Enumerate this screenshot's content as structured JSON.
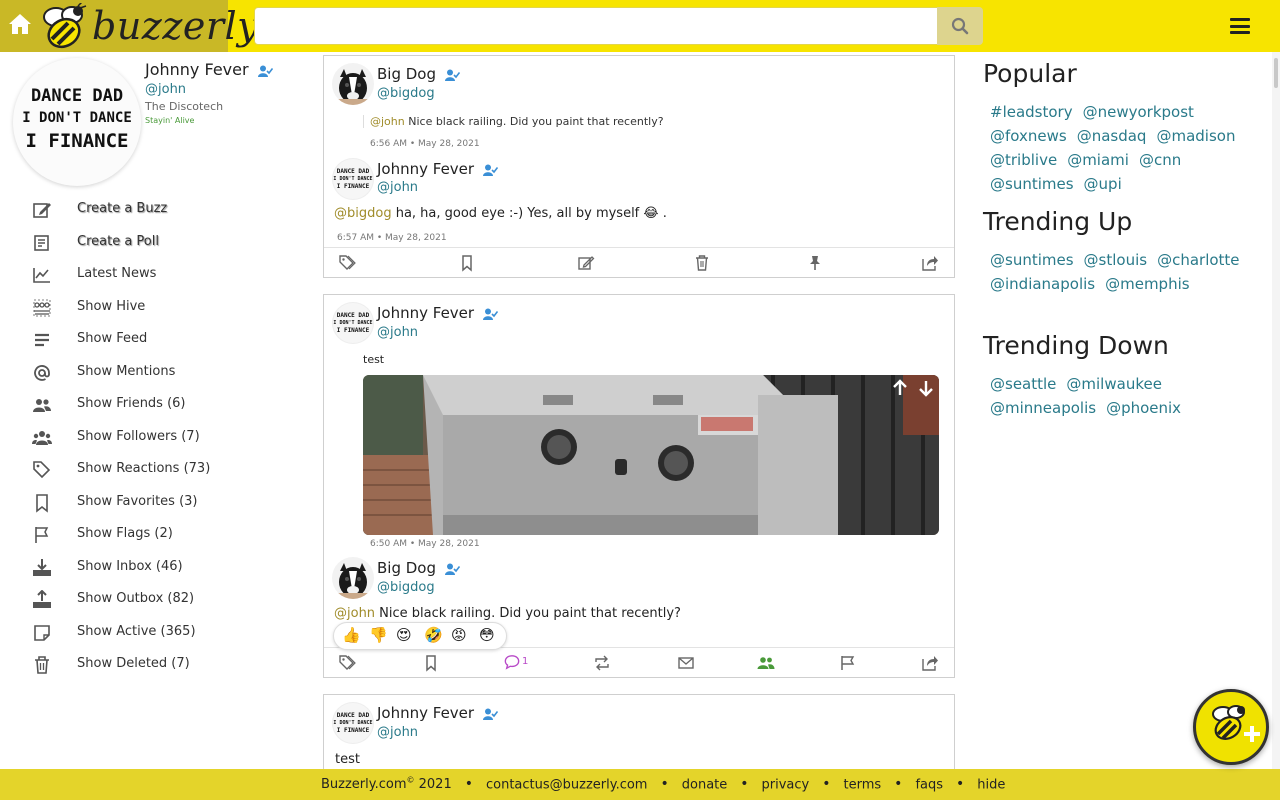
{
  "header": {
    "brand": "buzzerly",
    "search": {
      "value": "",
      "placeholder": ""
    }
  },
  "profile": {
    "avatar_lines": [
      "DANCE DAD",
      "I DON'T DANCE",
      "I FINANCE"
    ],
    "name": "Johnny Fever",
    "handle": "@john",
    "title": "The Discotech",
    "status": "Stayin' Alive"
  },
  "sidebar": {
    "items": [
      {
        "label": "Create a Buzz",
        "icon": "edit-icon"
      },
      {
        "label": "Create a Poll",
        "icon": "poll-icon"
      },
      {
        "label": "Latest News",
        "icon": "chart-line-icon"
      },
      {
        "label": "Show Hive",
        "icon": "hive-icon"
      },
      {
        "label": "Show Feed",
        "icon": "feed-icon"
      },
      {
        "label": "Show Mentions",
        "icon": "at-icon"
      },
      {
        "label": "Show Friends (6)",
        "icon": "friends-icon"
      },
      {
        "label": "Show Followers (7)",
        "icon": "followers-icon"
      },
      {
        "label": "Show Reactions (73)",
        "icon": "tags-icon"
      },
      {
        "label": "Show Favorites (3)",
        "icon": "bookmark-icon"
      },
      {
        "label": "Show Flags (2)",
        "icon": "flag-icon"
      },
      {
        "label": "Show Inbox (46)",
        "icon": "inbox-icon"
      },
      {
        "label": "Show Outbox (82)",
        "icon": "outbox-icon"
      },
      {
        "label": "Show Active (365)",
        "icon": "note-icon"
      },
      {
        "label": "Show Deleted (7)",
        "icon": "trash-icon"
      }
    ]
  },
  "feed": {
    "post1": {
      "author": "Big Dog",
      "handle": "@bigdog",
      "quote_mention": "@john",
      "quote_text": " Nice black railing. Did you paint that recently?",
      "quote_time": "6:56 AM • May 28, 2021",
      "reply_author": "Johnny Fever",
      "reply_handle": "@john",
      "reply_mention": "@bigdog",
      "reply_text": " ha, ha, good eye :-) Yes, all by myself ",
      "reply_emoji": "😂",
      "reply_end": " .",
      "reply_time": "6:57 AM • May 28, 2021"
    },
    "post2": {
      "author": "Johnny Fever",
      "handle": "@john",
      "text": "test",
      "time": "6:50 AM • May 28, 2021",
      "reply_author": "Big Dog",
      "reply_handle": "@bigdog",
      "reply_mention": "@john",
      "reply_text": " Nice black railing. Did you paint that recently?",
      "reactions": [
        "👍",
        "👎",
        "😍",
        "🤣",
        "😡",
        "😳"
      ],
      "comment_count": "1"
    },
    "post3": {
      "author": "Johnny Fever",
      "handle": "@john",
      "text": "test"
    }
  },
  "right": {
    "popular_title": "Popular",
    "popular": [
      "#leadstory",
      "@newyorkpost",
      "@foxnews",
      "@nasdaq",
      "@madison",
      "@triblive",
      "@miami",
      "@cnn",
      "@suntimes",
      "@upi"
    ],
    "trending_up_title": "Trending Up",
    "trending_up": [
      "@suntimes",
      "@stlouis",
      "@charlotte",
      "@indianapolis",
      "@memphis"
    ],
    "trending_down_title": "Trending Down",
    "trending_down": [
      "@seattle",
      "@milwaukee",
      "@minneapolis",
      "@phoenix"
    ]
  },
  "footer": {
    "copyright_prefix": "Buzzerly.com",
    "copyright_sup": "©",
    "copyright_year": " 2021",
    "links": [
      "contactus@buzzerly.com",
      "donate",
      "privacy",
      "terms",
      "faqs",
      "hide"
    ]
  },
  "colors": {
    "brand_yellow": "#f7e400",
    "brand_dark": "#c9b826",
    "link_teal": "#2a7a8a",
    "mention_gold": "#a08c2a"
  }
}
